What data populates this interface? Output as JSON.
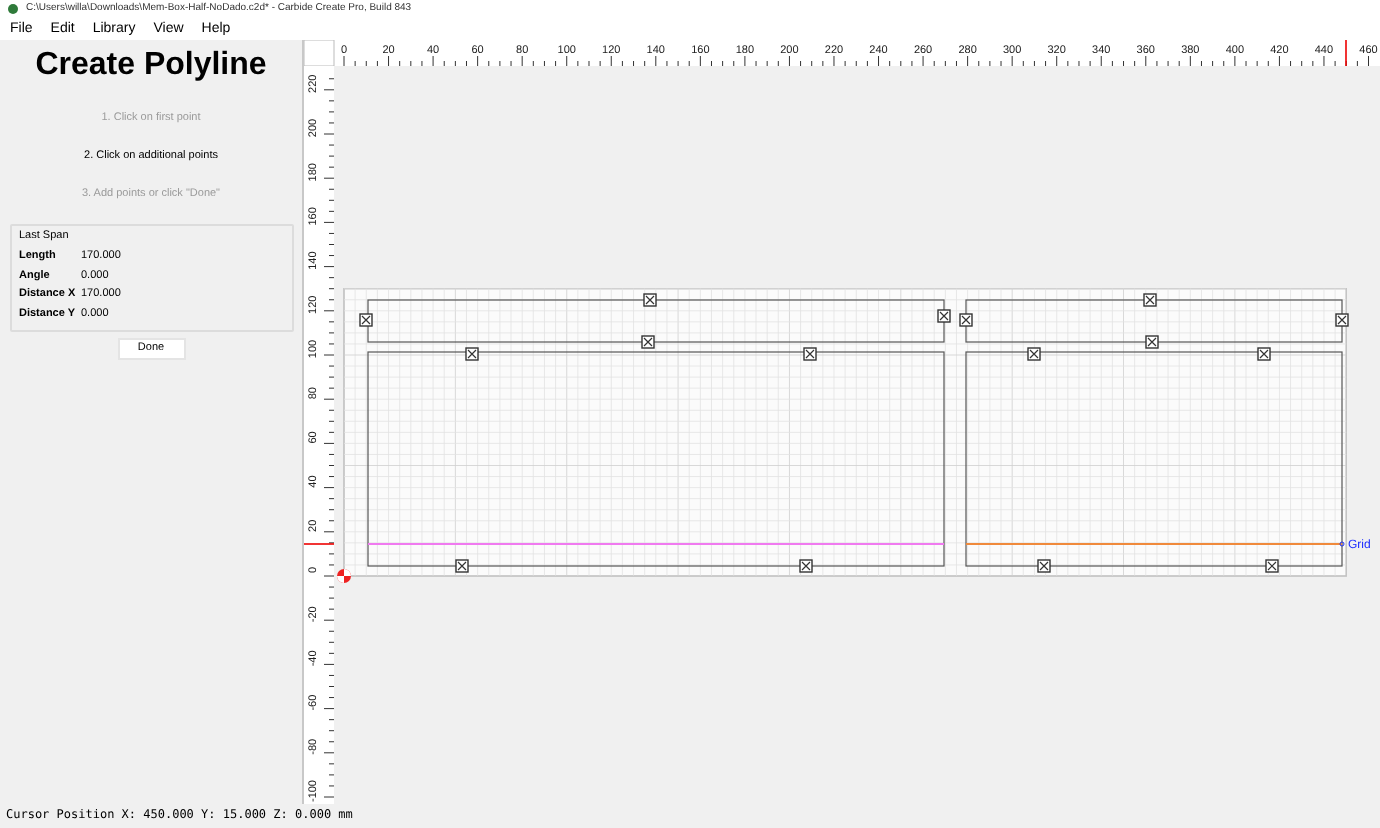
{
  "window": {
    "title": "C:\\Users\\willa\\Downloads\\Mem-Box-Half-NoDado.c2d* - Carbide Create Pro, Build 843"
  },
  "menu": [
    "File",
    "Edit",
    "Library",
    "View",
    "Help"
  ],
  "panel": {
    "title": "Create Polyline",
    "steps": [
      {
        "label": "1. Click on first point",
        "active": false
      },
      {
        "label": "2. Click on additional points",
        "active": true
      },
      {
        "label": "3. Add points or click \"Done\"",
        "active": false
      }
    ],
    "last_span": {
      "title": "Last Span",
      "rows": [
        {
          "label": "Length",
          "value": "170.000"
        },
        {
          "label": "Angle",
          "value": "0.000"
        },
        {
          "label": "Distance X",
          "value": "170.000"
        },
        {
          "label": "Distance Y",
          "value": "0.000"
        }
      ]
    },
    "done_button": "Done"
  },
  "rulers": {
    "x_labels": [
      "0",
      "20",
      "40",
      "60",
      "80",
      "100",
      "120",
      "140",
      "160",
      "180",
      "200",
      "220",
      "240",
      "260",
      "280",
      "300",
      "320",
      "340",
      "360",
      "380",
      "400",
      "420",
      "440",
      "460"
    ],
    "y_labels": [
      "220",
      "200",
      "180",
      "160",
      "140",
      "120",
      "100",
      "80",
      "60",
      "40",
      "20",
      "0",
      "-20",
      "-40",
      "-60",
      "-80",
      "-100"
    ]
  },
  "canvas": {
    "grid_label": "Grid"
  },
  "status_bar": "Cursor Position X: 450.000 Y: 15.000 Z: 0.000 mm"
}
